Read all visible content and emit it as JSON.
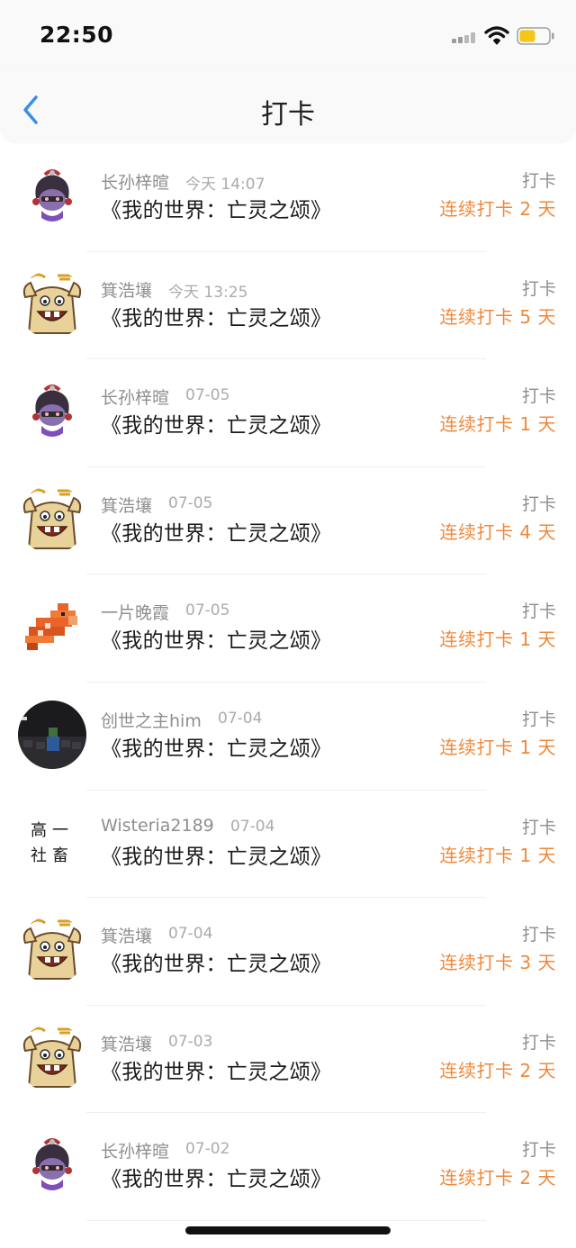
{
  "status_bar": {
    "time": "22:50"
  },
  "nav": {
    "title": "打卡"
  },
  "colors": {
    "accent_orange": "#f0883a",
    "back_blue": "#3a8ee6",
    "battery_yellow": "#f5c518"
  },
  "items": [
    {
      "user": "长孙梓暄",
      "time": "今天 14:07",
      "title": "《我的世界：亡灵之颂》",
      "label": "打卡",
      "streak": "连续打卡 2 天",
      "avatar": "masked-girl-avatar"
    },
    {
      "user": "箕浩壤",
      "time": "今天 13:25",
      "title": "《我的世界：亡灵之颂》",
      "label": "打卡",
      "streak": "连续打卡 5 天",
      "avatar": "cartoon-face-avatar"
    },
    {
      "user": "长孙梓暄",
      "time": "07-05",
      "title": "《我的世界：亡灵之颂》",
      "label": "打卡",
      "streak": "连续打卡 1 天",
      "avatar": "masked-girl-avatar"
    },
    {
      "user": "箕浩壤",
      "time": "07-05",
      "title": "《我的世界：亡灵之颂》",
      "label": "打卡",
      "streak": "连续打卡 4 天",
      "avatar": "cartoon-face-avatar"
    },
    {
      "user": "一片晚霞",
      "time": "07-05",
      "title": "《我的世界：亡灵之颂》",
      "label": "打卡",
      "streak": "连续打卡 1 天",
      "avatar": "pixel-fish-avatar"
    },
    {
      "user": "创世之主him",
      "time": "07-04",
      "title": "《我的世界：亡灵之颂》",
      "label": "打卡",
      "streak": "连续打卡 1 天",
      "avatar": "dark-photo-avatar"
    },
    {
      "user": "Wisteria2189",
      "time": "07-04",
      "title": "《我的世界：亡灵之颂》",
      "label": "打卡",
      "streak": "连续打卡 1 天",
      "avatar": "calligraphy-avatar",
      "avatar_text": [
        "高一",
        "社畜"
      ]
    },
    {
      "user": "箕浩壤",
      "time": "07-04",
      "title": "《我的世界：亡灵之颂》",
      "label": "打卡",
      "streak": "连续打卡 3 天",
      "avatar": "cartoon-face-avatar"
    },
    {
      "user": "箕浩壤",
      "time": "07-03",
      "title": "《我的世界：亡灵之颂》",
      "label": "打卡",
      "streak": "连续打卡 2 天",
      "avatar": "cartoon-face-avatar"
    },
    {
      "user": "长孙梓暄",
      "time": "07-02",
      "title": "《我的世界：亡灵之颂》",
      "label": "打卡",
      "streak": "连续打卡 2 天",
      "avatar": "masked-girl-avatar"
    }
  ]
}
